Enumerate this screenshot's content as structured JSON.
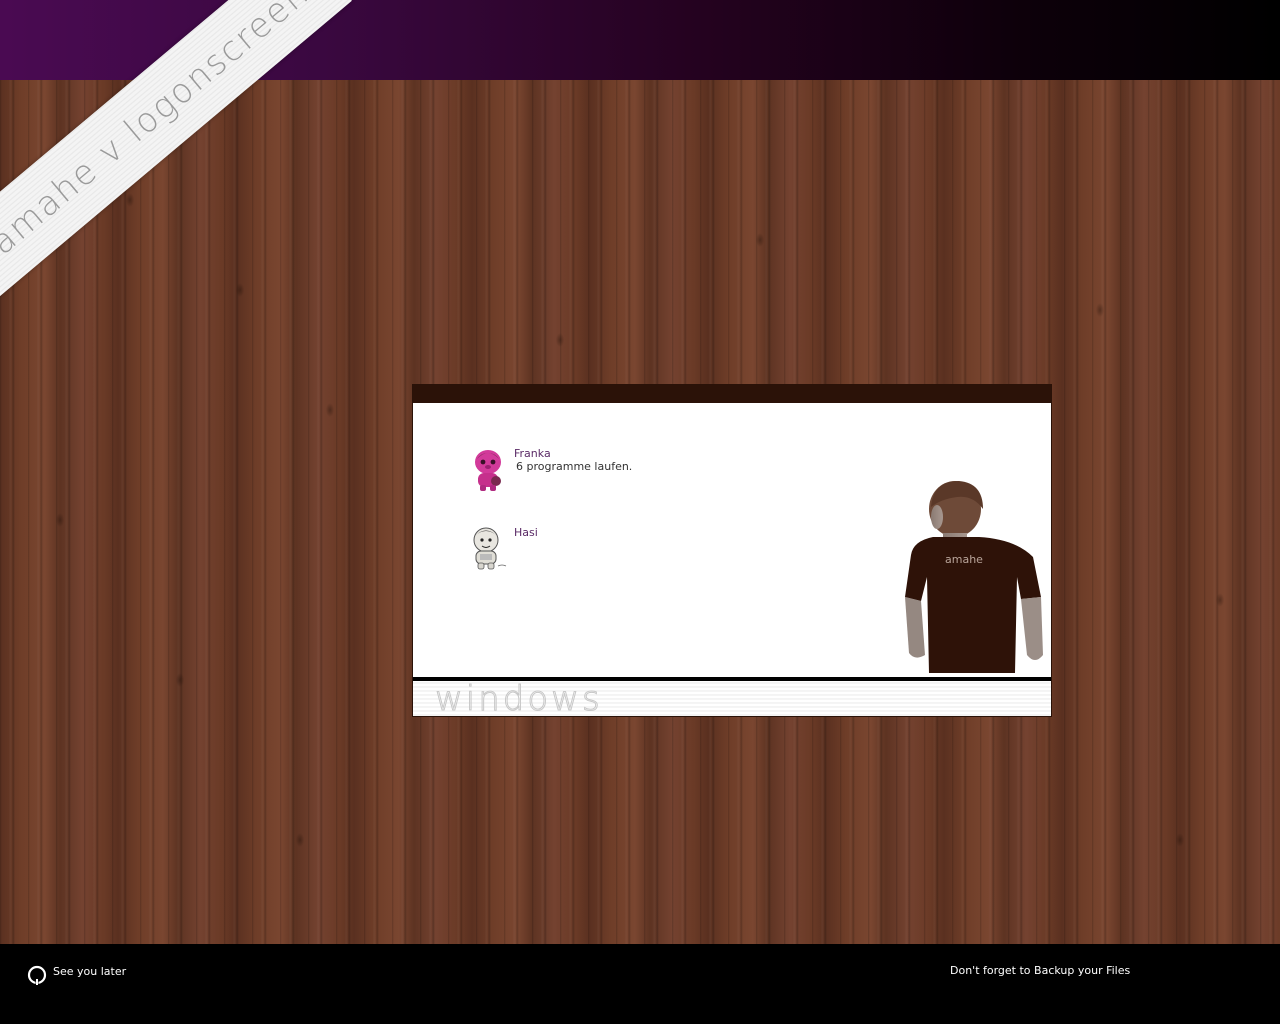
{
  "header": {
    "corner_banner": "amahe v logonscreen"
  },
  "logon_panel": {
    "users": [
      {
        "name": "Franka",
        "status": "6 programme laufen.",
        "avatar": "pink-figure-avatar"
      },
      {
        "name": "Hasi",
        "status": "",
        "avatar": "grey-figure-avatar"
      }
    ],
    "shirt_text": "amahe",
    "brand_text": "windows"
  },
  "footer": {
    "shutdown_label": "See you later",
    "notice": "Don't forget to Backup your Files"
  },
  "colors": {
    "header_gradient_start": "#4a0a52",
    "header_gradient_end": "#000000",
    "panel_top_bar": "#2b1208",
    "user_name": "#5a2a66",
    "wood": "#6b3a25"
  }
}
